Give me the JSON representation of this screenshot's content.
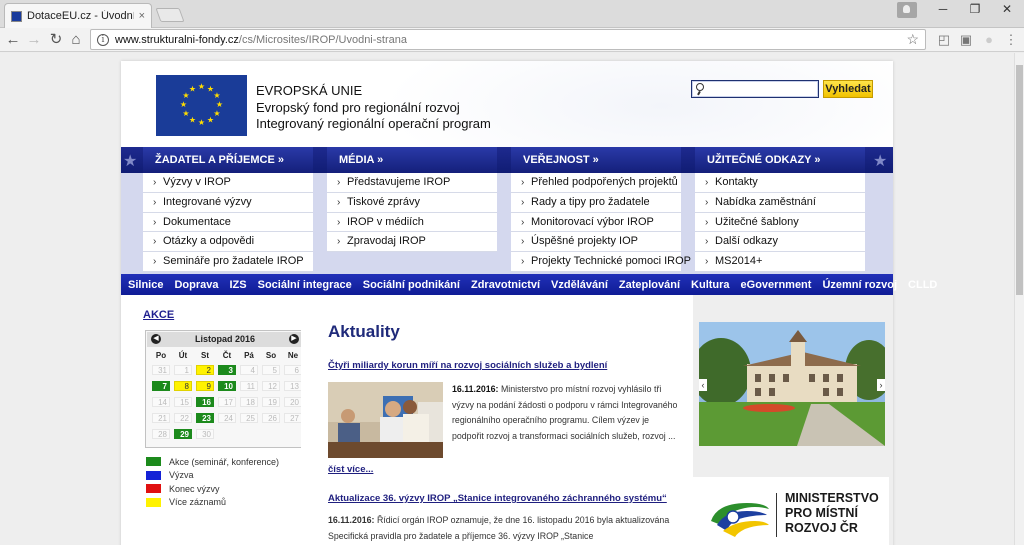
{
  "browser": {
    "tab_title": "DotaceEU.cz - Úvodní str",
    "tab_close": "×",
    "url_host": "www.strukturalni-fondy.cz",
    "url_path": "/cs/Microsites/IROP/Uvodni-strana",
    "btn_minimize": "─",
    "btn_restore": "❐",
    "btn_close": "✕"
  },
  "header": {
    "title": "EVROPSKÁ UNIE",
    "line1": "Evropský fond pro regionální rozvoj",
    "line2": "Integrovaný regionální operační program",
    "search_placeholder": "",
    "search_button": "Vyhledat"
  },
  "mega_menu": [
    {
      "heading": "ŽADATEL A PŘÍJEMCE »",
      "items": [
        "Výzvy v IROP",
        "Integrované výzvy",
        "Dokumentace",
        "Otázky a odpovědi",
        "Semináře pro žadatele IROP"
      ]
    },
    {
      "heading": "MÉDIA »",
      "items": [
        "Představujeme IROP",
        "Tiskové zprávy",
        "IROP v médiích",
        "Zpravodaj IROP"
      ]
    },
    {
      "heading": "VEŘEJNOST »",
      "items": [
        "Přehled podpořených projektů",
        "Rady a tipy pro žadatele",
        "Monitorovací výbor IROP",
        "Úspěšné projekty IOP",
        "Projekty Technické pomoci IROP"
      ]
    },
    {
      "heading": "UŽITEČNÉ ODKAZY »",
      "items": [
        "Kontakty",
        "Nabídka zaměstnání",
        "Užitečné šablony",
        "Další odkazy",
        "MS2014+"
      ]
    }
  ],
  "topics": [
    "Silnice",
    "Doprava",
    "IZS",
    "Sociální integrace",
    "Sociální podnikání",
    "Zdravotnictví",
    "Vzdělávání",
    "Zateplování",
    "Kultura",
    "eGovernment",
    "Územní rozvoj",
    "CLLD"
  ],
  "calendar": {
    "link": "AKCE",
    "month": "Listopad 2016",
    "dow": [
      "Po",
      "Út",
      "St",
      "Čt",
      "Pá",
      "So",
      "Ne"
    ],
    "weeks": [
      [
        [
          "31",
          "gray0"
        ],
        [
          "1",
          "dim"
        ],
        [
          "2",
          "yellow"
        ],
        [
          "3",
          "green"
        ],
        [
          "4",
          "dim"
        ],
        [
          "5",
          "dim"
        ],
        [
          "6",
          "dim"
        ]
      ],
      [
        [
          "7",
          "green"
        ],
        [
          "8",
          "yellow"
        ],
        [
          "9",
          "yellow"
        ],
        [
          "10",
          "green"
        ],
        [
          "11",
          "dim"
        ],
        [
          "12",
          "dim"
        ],
        [
          "13",
          "dim"
        ]
      ],
      [
        [
          "14",
          "dim"
        ],
        [
          "15",
          "dim"
        ],
        [
          "16",
          "green"
        ],
        [
          "17",
          "dim"
        ],
        [
          "18",
          "dim"
        ],
        [
          "19",
          "dim"
        ],
        [
          "20",
          "dim"
        ]
      ],
      [
        [
          "21",
          "dim"
        ],
        [
          "22",
          "dim"
        ],
        [
          "23",
          "green"
        ],
        [
          "24",
          "dim"
        ],
        [
          "25",
          "dim"
        ],
        [
          "26",
          "dim"
        ],
        [
          "27",
          "dim"
        ]
      ],
      [
        [
          "28",
          "dim"
        ],
        [
          "29",
          "green"
        ],
        [
          "30",
          "dim"
        ],
        [
          "",
          "none"
        ],
        [
          "",
          "none"
        ],
        [
          "",
          "none"
        ],
        [
          "",
          "none"
        ]
      ]
    ],
    "legend": [
      {
        "label": "Akce (seminář, konference)",
        "color": "#1c8a1c"
      },
      {
        "label": "Výzva",
        "color": "#1422d6"
      },
      {
        "label": "Konec výzvy",
        "color": "#e01010"
      },
      {
        "label": "Více záznamů",
        "color": "#fff200"
      }
    ]
  },
  "news": {
    "heading": "Aktuality",
    "item1_title": "Čtyři miliardy korun míří na rozvoj sociálních služeb a bydlení",
    "item1_date": "16.11.2016:",
    "item1_text": "Ministerstvo pro místní rozvoj vyhlásilo tři výzvy na podání žádosti o podporu v rámci Integrovaného regionálního operačního programu. Cílem výzev je podpořit rozvoj a transformaci sociálních služeb, rozvoj ...",
    "read_more": "číst více...",
    "item2_title": "Aktualizace 36. výzvy IROP „Stanice integrovaného záchranného systému“",
    "item2_date": "16.11.2016:",
    "item2_text": "Řídicí orgán IROP oznamuje, že dne 16. listopadu 2016 byla aktualizována Specifická pravidla pro žadatele a příjemce 36. výzvy IROP „Stanice"
  },
  "ministry": {
    "line1": "MINISTERSTVO",
    "line2": "PRO MÍSTNÍ",
    "line3": "ROZVOJ ČR"
  },
  "colors": {
    "menu_blue": "#141f7a",
    "topic_blue": "#1524a8",
    "accent_yellow": "#f1c200",
    "link_blue": "#1f1f8f"
  }
}
